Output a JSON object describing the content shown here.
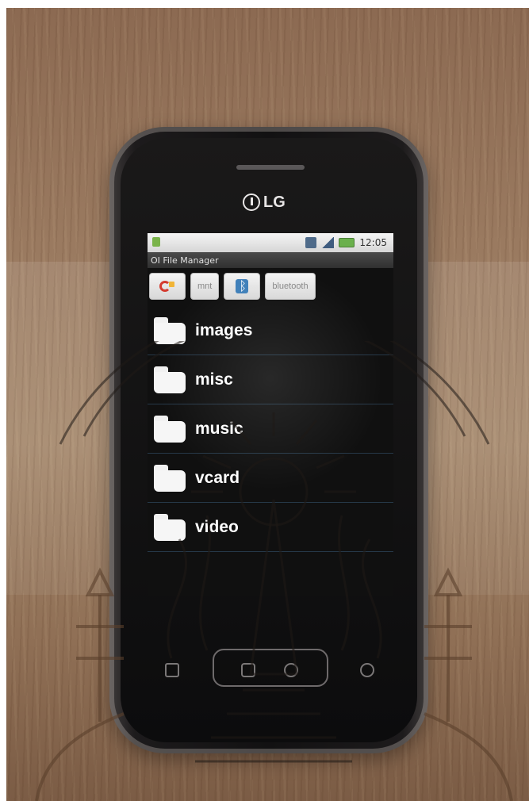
{
  "device": {
    "brand": "LG"
  },
  "status_bar": {
    "time": "12:05"
  },
  "app": {
    "title": "OI File Manager",
    "toolbar": {
      "mnt_label": "mnt",
      "bluetooth_label": "bluetooth"
    },
    "folders": [
      {
        "name": "images"
      },
      {
        "name": "misc"
      },
      {
        "name": "music"
      },
      {
        "name": "vcard"
      },
      {
        "name": "video"
      }
    ]
  },
  "colors": {
    "list_background": "#101010",
    "folder_icon": "#f6f6f6",
    "status_bar_bg": "#d6d6d6",
    "watermark": "#1f1a16"
  },
  "icons": {
    "home": "home-icon",
    "bluetooth": "bluetooth-icon",
    "folder": "folder-icon",
    "back": "back-icon",
    "search": "search-icon"
  }
}
